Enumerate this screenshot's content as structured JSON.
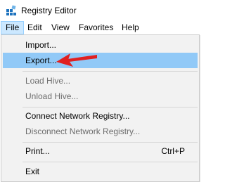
{
  "window": {
    "title": "Registry Editor",
    "icon": "registry-editor-icon"
  },
  "menubar": {
    "items": [
      {
        "label": "File",
        "active": true
      },
      {
        "label": "Edit"
      },
      {
        "label": "View"
      },
      {
        "label": "Favorites"
      },
      {
        "label": "Help"
      }
    ]
  },
  "file_menu": {
    "items": [
      {
        "label": "Import...",
        "enabled": true
      },
      {
        "label": "Export...",
        "enabled": true,
        "highlighted": true
      },
      {
        "label": "Load Hive...",
        "enabled": false
      },
      {
        "label": "Unload Hive...",
        "enabled": false
      },
      {
        "label": "Connect Network Registry...",
        "enabled": true
      },
      {
        "label": "Disconnect Network Registry...",
        "enabled": false
      },
      {
        "label": "Print...",
        "shortcut": "Ctrl+P",
        "enabled": true
      },
      {
        "label": "Exit",
        "enabled": true
      }
    ]
  },
  "annotation": {
    "arrow_color": "#e02020",
    "points_to": "Export..."
  },
  "colors": {
    "highlight": "#91c9f7",
    "menubar_active": "#cce8ff",
    "menu_background": "#f2f2f2",
    "disabled_text": "#6d6d6d"
  }
}
